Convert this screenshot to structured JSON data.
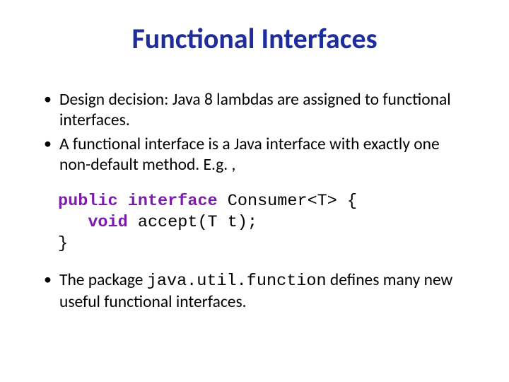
{
  "title": "Functional Interfaces",
  "bullets": {
    "b1": "Design decision: Java 8 lambdas are assigned to functional interfaces.",
    "b2": "A functional interface is a Java interface with exactly one non-default method.  E.g. ,",
    "b3_pre": "The package ",
    "b3_code": "java.util.function",
    "b3_post": " defines many new useful functional interfaces."
  },
  "code": {
    "kw_public": "public",
    "kw_interface": "interface",
    "kw_void": "void",
    "line1_rest": " Consumer<T> {",
    "line2_rest": " accept(T t);",
    "line3": "}"
  }
}
